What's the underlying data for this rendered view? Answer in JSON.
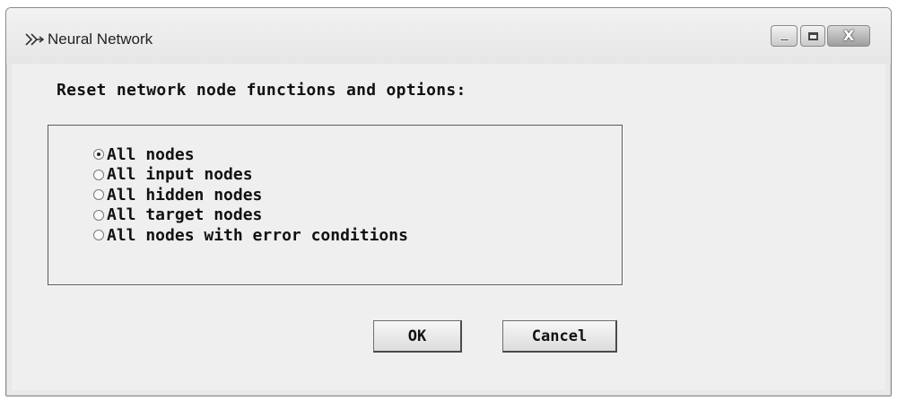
{
  "window": {
    "title": "Neural Network",
    "icon": "neural-network-app-icon",
    "controls": {
      "minimize": "minimize-icon",
      "maximize": "maximize-icon",
      "close_symbol": "X"
    }
  },
  "dialog": {
    "heading": "Reset network node functions and options:",
    "options": [
      {
        "label": "All nodes",
        "checked": true
      },
      {
        "label": "All input nodes",
        "checked": false
      },
      {
        "label": "All hidden nodes",
        "checked": false
      },
      {
        "label": "All target nodes",
        "checked": false
      },
      {
        "label": "All nodes with error conditions",
        "checked": false
      }
    ],
    "buttons": {
      "ok": "OK",
      "cancel": "Cancel"
    }
  }
}
